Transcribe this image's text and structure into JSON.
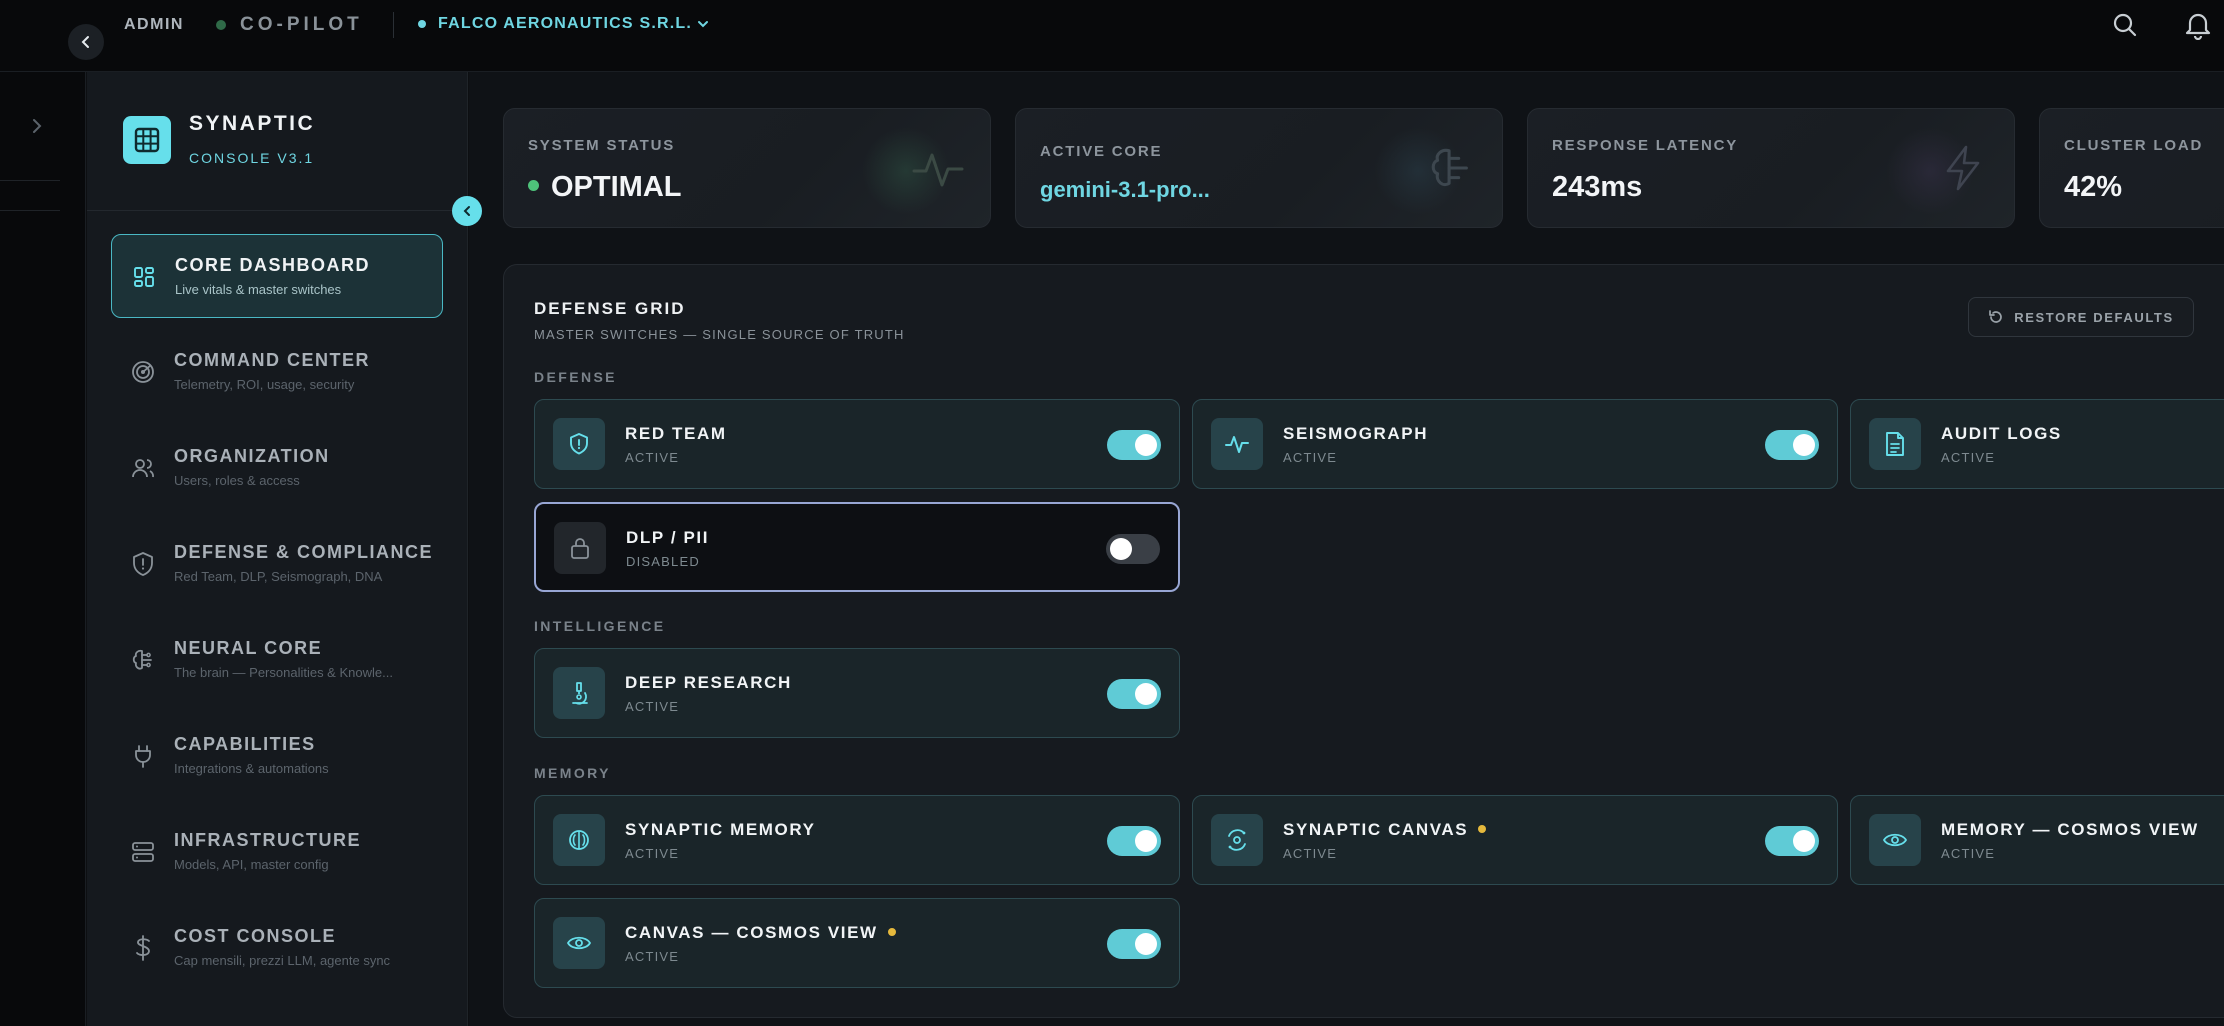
{
  "topbar": {
    "admin_label": "ADMIN",
    "copilot_label": "CO-PILOT",
    "org_name": "FALCO AERONAUTICS S.R.L."
  },
  "sidebar": {
    "brand_title": "SYNAPTIC",
    "brand_subtitle": "CONSOLE V3.1",
    "items": [
      {
        "title": "CORE DASHBOARD",
        "subtitle": "Live vitals & master switches",
        "icon": "dashboard-icon",
        "active": true
      },
      {
        "title": "COMMAND CENTER",
        "subtitle": "Telemetry, ROI, usage, security",
        "icon": "radar-icon",
        "active": false
      },
      {
        "title": "ORGANIZATION",
        "subtitle": "Users, roles & access",
        "icon": "users-icon",
        "active": false
      },
      {
        "title": "DEFENSE & COMPLIANCE",
        "subtitle": "Red Team, DLP, Seismograph, DNA",
        "icon": "shield-icon",
        "active": false
      },
      {
        "title": "NEURAL CORE",
        "subtitle": "The brain — Personalities & Knowle...",
        "icon": "brain-icon",
        "active": false
      },
      {
        "title": "CAPABILITIES",
        "subtitle": "Integrations & automations",
        "icon": "plug-icon",
        "active": false
      },
      {
        "title": "INFRASTRUCTURE",
        "subtitle": "Models, API, master config",
        "icon": "server-icon",
        "active": false
      },
      {
        "title": "COST CONSOLE",
        "subtitle": "Cap mensili, prezzi LLM, agente sync",
        "icon": "dollar-icon",
        "active": false
      }
    ]
  },
  "stats": [
    {
      "label": "SYSTEM STATUS",
      "value": "OPTIMAL",
      "icon": "pulse-icon"
    },
    {
      "label": "ACTIVE CORE",
      "value": "gemini-3.1-pro...",
      "icon": "brain-icon"
    },
    {
      "label": "RESPONSE LATENCY",
      "value": "243ms",
      "icon": "bolt-icon"
    },
    {
      "label": "CLUSTER LOAD",
      "value": "42%",
      "icon": "chip-icon"
    }
  ],
  "defense_grid": {
    "title": "DEFENSE GRID",
    "subtitle": "MASTER SWITCHES — SINGLE SOURCE OF TRUTH",
    "restore_label": "RESTORE DEFAULTS",
    "sections": {
      "defense": "DEFENSE",
      "intelligence": "INTELLIGENCE",
      "memory": "MEMORY"
    },
    "modules": {
      "red_team": {
        "name": "RED TEAM",
        "state": "ACTIVE",
        "on": true
      },
      "seismograph": {
        "name": "SEISMOGRAPH",
        "state": "ACTIVE",
        "on": true
      },
      "audit_logs": {
        "name": "AUDIT LOGS",
        "state": "ACTIVE",
        "on": true
      },
      "dlp_pii": {
        "name": "DLP / PII",
        "state": "DISABLED",
        "on": false
      },
      "deep_research": {
        "name": "DEEP RESEARCH",
        "state": "ACTIVE",
        "on": true
      },
      "synaptic_memory": {
        "name": "SYNAPTIC MEMORY",
        "state": "ACTIVE",
        "on": true
      },
      "synaptic_canvas": {
        "name": "SYNAPTIC CANVAS",
        "state": "ACTIVE",
        "on": true
      },
      "memory_cosmos": {
        "name": "MEMORY — COSMOS VIEW",
        "state": "ACTIVE",
        "on": true
      },
      "canvas_cosmos": {
        "name": "CANVAS — COSMOS VIEW",
        "state": "ACTIVE",
        "on": true
      }
    }
  },
  "colors": {
    "accent": "#66dfeb",
    "status_ok": "#4ec27a",
    "badge_warn": "#e5b93c",
    "disabled_border": "#98a6d4"
  }
}
